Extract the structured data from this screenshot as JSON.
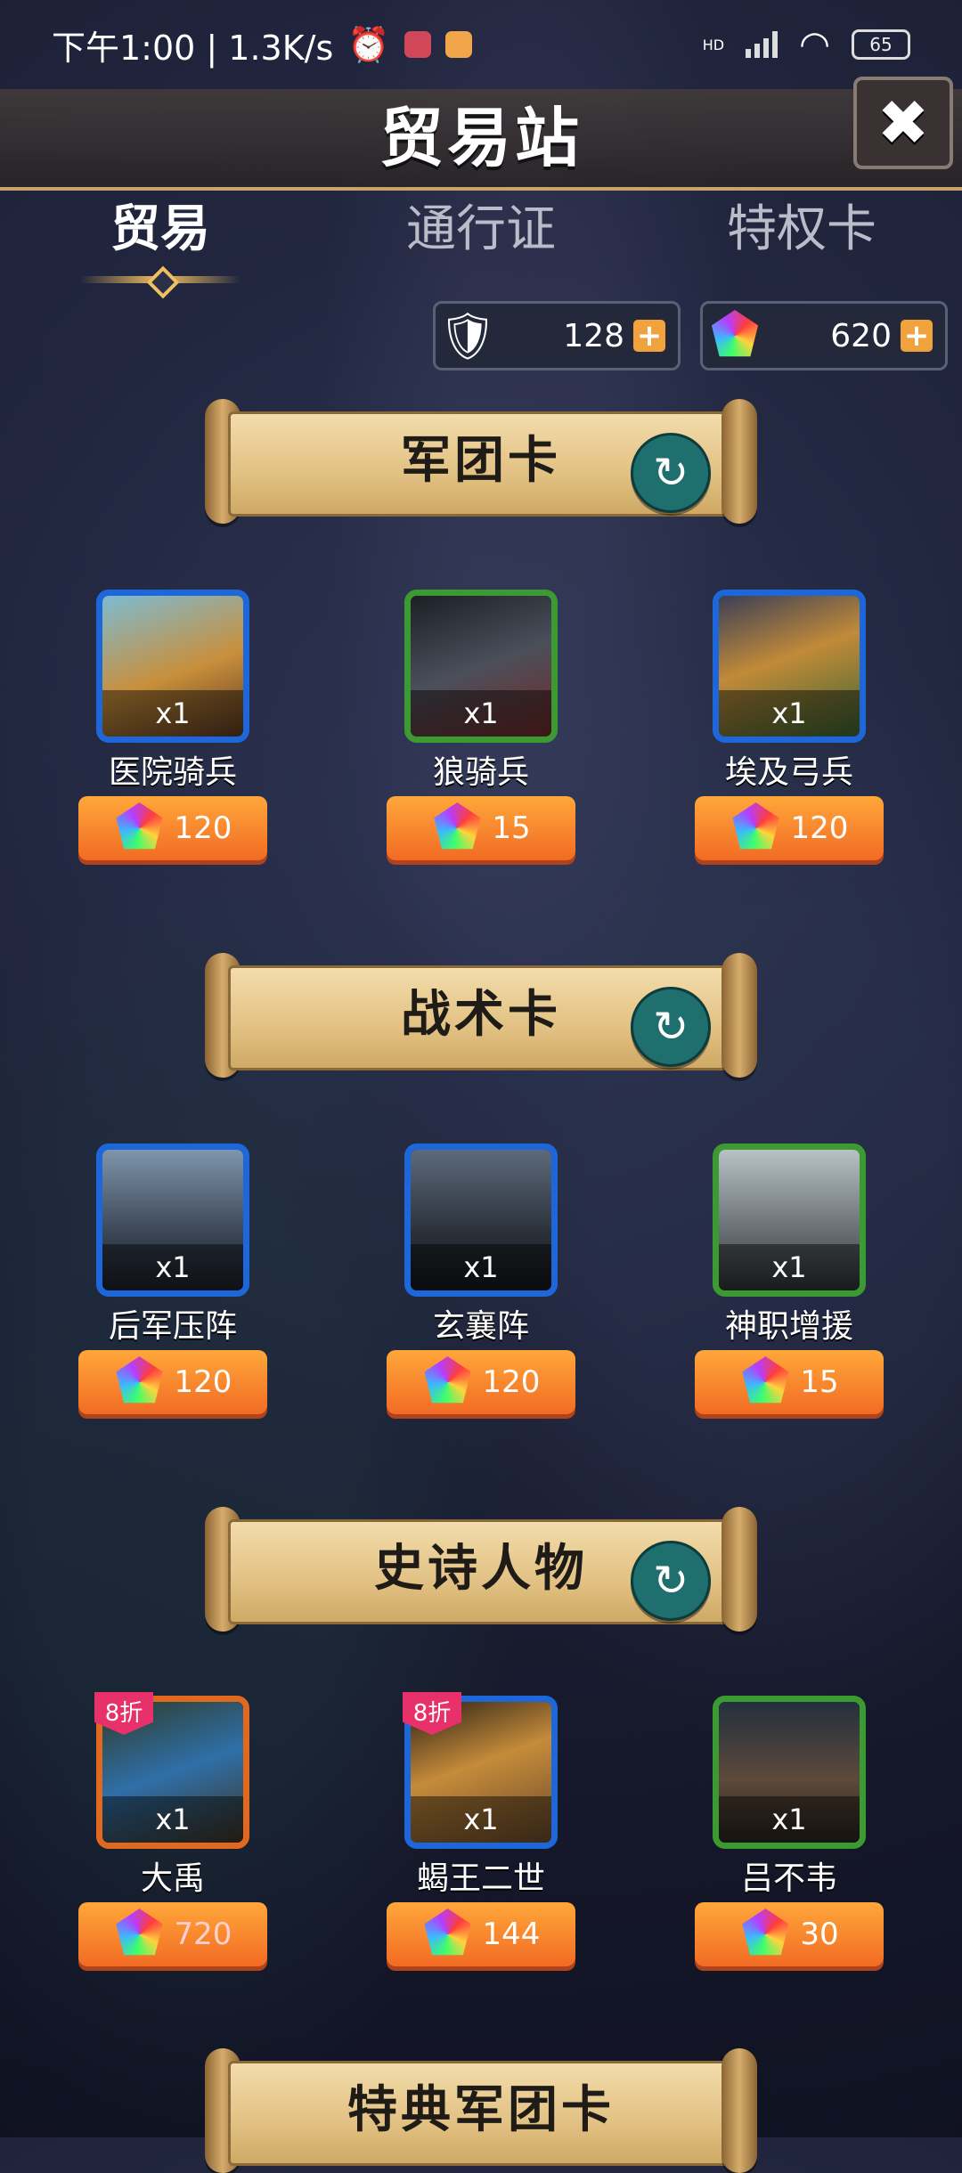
{
  "status_bar": {
    "time_speed": "下午1:00 | 1.3K/s",
    "signal_label": "HD",
    "battery": "65"
  },
  "header": {
    "title": "贸易站"
  },
  "tabs": [
    {
      "label": "贸易",
      "active": true
    },
    {
      "label": "通行证",
      "active": false
    },
    {
      "label": "特权卡",
      "active": false
    }
  ],
  "currencies": [
    {
      "icon": "emblem-icon",
      "value": "128"
    },
    {
      "icon": "gem-icon",
      "value": "620"
    }
  ],
  "sections": [
    {
      "title": "军团卡",
      "items": [
        {
          "name": "医院骑兵",
          "count": "x1",
          "price": "120",
          "frame": "blue",
          "discount": ""
        },
        {
          "name": "狼骑兵",
          "count": "x1",
          "price": "15",
          "frame": "green",
          "discount": ""
        },
        {
          "name": "埃及弓兵",
          "count": "x1",
          "price": "120",
          "frame": "blue",
          "discount": ""
        }
      ]
    },
    {
      "title": "战术卡",
      "items": [
        {
          "name": "后军压阵",
          "count": "x1",
          "price": "120",
          "frame": "blue",
          "discount": ""
        },
        {
          "name": "玄襄阵",
          "count": "x1",
          "price": "120",
          "frame": "blue",
          "discount": ""
        },
        {
          "name": "神职增援",
          "count": "x1",
          "price": "15",
          "frame": "green",
          "discount": ""
        }
      ]
    },
    {
      "title": "史诗人物",
      "items": [
        {
          "name": "大禹",
          "count": "x1",
          "price": "720",
          "frame": "orange",
          "discount": "8折"
        },
        {
          "name": "蝎王二世",
          "count": "x1",
          "price": "144",
          "frame": "blue",
          "discount": "8折"
        },
        {
          "name": "吕不韦",
          "count": "x1",
          "price": "30",
          "frame": "green",
          "discount": ""
        }
      ]
    },
    {
      "title": "特典军团卡",
      "items": []
    }
  ],
  "colors": {
    "accent_gold": "#f0c060",
    "price_orange": "#f26b24",
    "frame_blue": "#1e67da",
    "frame_green": "#3c9a32",
    "frame_orange": "#e0691f",
    "refresh_teal": "#1f6f6f"
  }
}
